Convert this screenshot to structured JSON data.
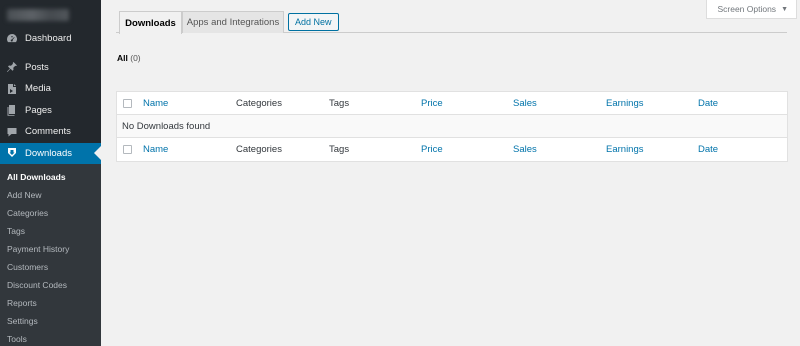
{
  "sidebar": {
    "items": [
      {
        "label": "Dashboard",
        "icon": "dashboard-icon"
      },
      {
        "label": "Posts",
        "icon": "pin-icon"
      },
      {
        "label": "Media",
        "icon": "media-icon"
      },
      {
        "label": "Pages",
        "icon": "pages-icon"
      },
      {
        "label": "Comments",
        "icon": "comment-icon"
      },
      {
        "label": "Downloads",
        "icon": "download-icon"
      }
    ],
    "submenu": [
      "All Downloads",
      "Add New",
      "Categories",
      "Tags",
      "Payment History",
      "Customers",
      "Discount Codes",
      "Reports",
      "Settings",
      "Tools"
    ]
  },
  "header": {
    "screen_options": "Screen Options",
    "tabs": [
      {
        "label": "Downloads"
      },
      {
        "label": "Apps and Integrations"
      }
    ],
    "add_new": "Add New"
  },
  "filter": {
    "all_label": "All",
    "all_count": "(0)"
  },
  "table": {
    "columns": [
      "Name",
      "Categories",
      "Tags",
      "Price",
      "Sales",
      "Earnings",
      "Date"
    ],
    "empty_message": "No Downloads found"
  },
  "colors": {
    "sidebar_bg": "#23282d",
    "accent": "#0073aa",
    "page_bg": "#f1f1f1"
  }
}
